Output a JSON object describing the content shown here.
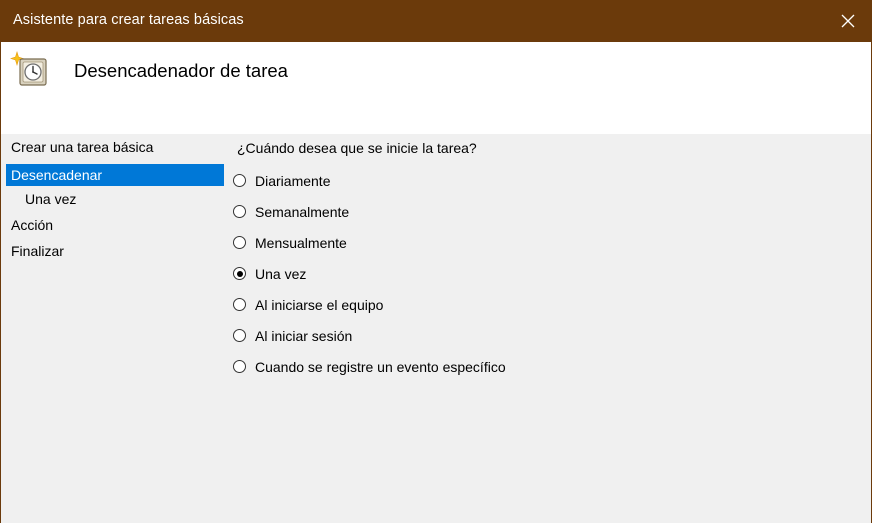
{
  "window": {
    "title": "Asistente para crear tareas básicas",
    "close_icon": "close-icon",
    "titlebar_color": "#6b3a0b"
  },
  "header": {
    "icon": "task-scheduler-clock-icon",
    "title": "Desencadenador de tarea"
  },
  "sidebar": {
    "items": [
      {
        "label": "Crear una tarea básica",
        "selected": false,
        "indent": false
      },
      {
        "label": "Desencadenar",
        "selected": true,
        "indent": false
      },
      {
        "label": "Una vez",
        "selected": false,
        "indent": true
      },
      {
        "label": "Acción",
        "selected": false,
        "indent": false
      },
      {
        "label": "Finalizar",
        "selected": false,
        "indent": false
      }
    ],
    "selected_color": "#0078d7"
  },
  "main": {
    "question": "¿Cuándo desea que se inicie la tarea?",
    "options": [
      {
        "label": "Diariamente",
        "checked": false
      },
      {
        "label": "Semanalmente",
        "checked": false
      },
      {
        "label": "Mensualmente",
        "checked": false
      },
      {
        "label": "Una vez",
        "checked": true
      },
      {
        "label": "Al iniciarse el equipo",
        "checked": false
      },
      {
        "label": "Al iniciar sesión",
        "checked": false
      },
      {
        "label": "Cuando se registre un evento específico",
        "checked": false
      }
    ]
  }
}
